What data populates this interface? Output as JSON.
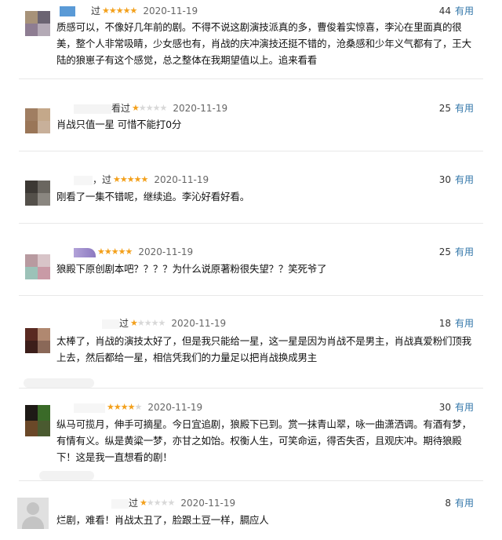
{
  "common": {
    "useful_label": "有用"
  },
  "reviews": [
    {
      "user": "过",
      "stars": 5,
      "date": "2020-11-19",
      "votes": "44",
      "text": "质感可以，不像好几年前的剧。不得不说这剧演技派真的多，曹俊着实惊喜，李沁在里面真的很美，整个人非常吸睛，少女感也有，肖战的庆冲演技还挺不错的，沧桑感和少年义气都有了，王大陆的狼崽子有这个感觉，总之整体在我期望值以上。追来看看"
    },
    {
      "user": "看过",
      "stars": 1,
      "date": "2020-11-19",
      "votes": "25",
      "text": "肖战只值一星 可惜不能打0分"
    },
    {
      "user": "，过",
      "stars": 5,
      "date": "2020-11-19",
      "votes": "30",
      "text": "刚看了一集不错呢，继续追。李沁好看好看。"
    },
    {
      "user": "",
      "stars": 5,
      "date": "2020-11-19",
      "votes": "25",
      "text": "狼殿下原创剧本吧？？？？为什么说原著粉很失望？？笑死爷了"
    },
    {
      "user": "过",
      "stars": 1,
      "date": "2020-11-19",
      "votes": "18",
      "text": "太棒了，肖战的演技太好了，但是我只能给一星，这一星是因为肖战不是男主，肖战真爱粉们顶我上去，然后都给一星，相信凭我们的力量足以把肖战换成男主"
    },
    {
      "user": "",
      "stars": 4,
      "date": "2020-11-19",
      "votes": "30",
      "text": "纵马可揽月，伸手可摘星。今日宜追剧，狼殿下已到。赏一抹青山翠，咏一曲潇洒调。有酒有梦，有情有义。纵是黄粱一梦，亦甘之如饴。权衡人生，可笑命运，得否失否，且观庆冲。期待狼殿下！这是我一直想看的剧！"
    },
    {
      "user": "过",
      "stars": 1,
      "date": "2020-11-19",
      "votes": "8",
      "text": "烂剧，难看！肖战太丑了，脸跟土豆一样，膈应人"
    }
  ]
}
